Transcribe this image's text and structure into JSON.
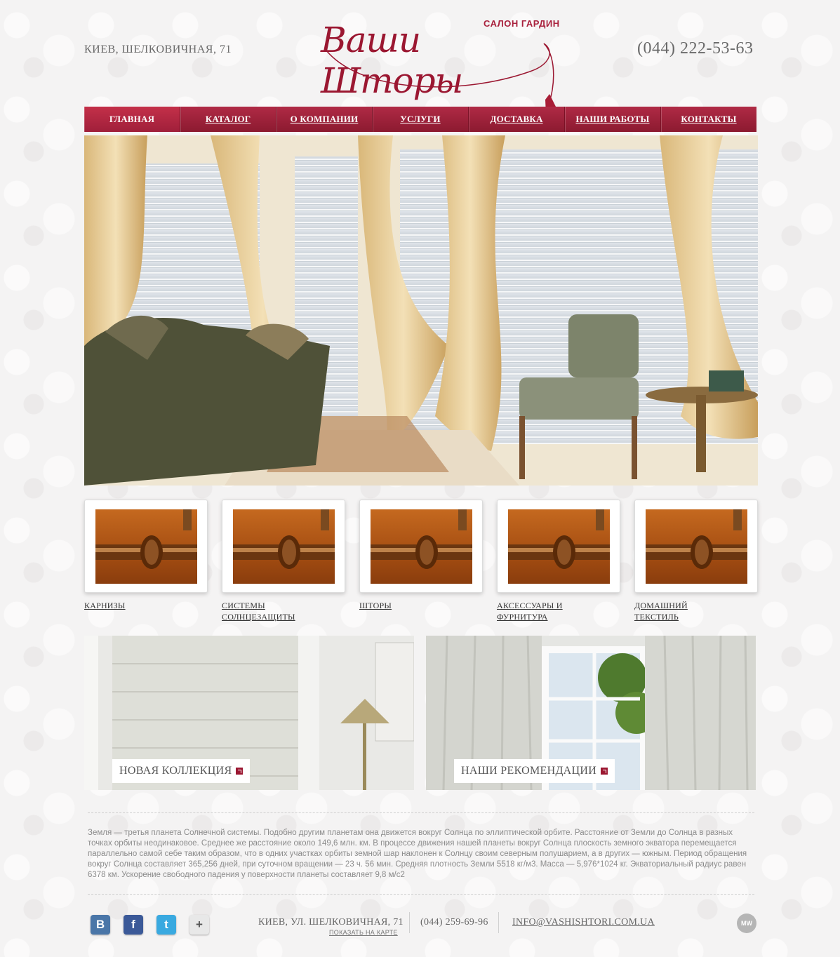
{
  "header": {
    "address": "КИЕВ, ШЕЛКОВИЧНАЯ, 71",
    "phone": "(044) 222-53-63",
    "logo_subtitle": "САЛОН ГАРДИН",
    "logo_title": "Ваши Шторы"
  },
  "nav": {
    "items": [
      {
        "label": "ГЛАВНАЯ",
        "active": true
      },
      {
        "label": "КАТАЛОГ"
      },
      {
        "label": "О КОМПАНИИ"
      },
      {
        "label": "УСЛУГИ"
      },
      {
        "label": "ДОСТАВКА"
      },
      {
        "label": "НАШИ РАБОТЫ"
      },
      {
        "label": "КОНТАКТЫ"
      }
    ]
  },
  "categories": [
    {
      "line1": "КАРНИЗЫ",
      "line2": ""
    },
    {
      "line1": "СИСТЕМЫ",
      "line2": "СОЛНЦЕЗАЩИТЫ"
    },
    {
      "line1": "ШТОРЫ",
      "line2": ""
    },
    {
      "line1": "АКСЕССУАРЫ И",
      "line2": "ФУРНИТУРА"
    },
    {
      "line1": "ДОМАШНИЙ",
      "line2": "ТЕКСТИЛЬ"
    }
  ],
  "promos": {
    "new_collection": "НОВАЯ КОЛЛЕКЦИЯ",
    "recommendations": "НАШИ РЕКОМЕНДАЦИИ"
  },
  "about_text": "Земля — третья планета Солнечной системы. Подобно другим планетам она движется вокруг Солнца по эллиптической орбите. Расстояние от Земли до Солнца в разных точках орбиты неодинаковое. Среднее же расстояние около 149,6 млн. км. В процессе движения нашей планеты вокруг Солнца плоскость земного экватора перемещается параллельно самой себе таким образом, что в одних участках орбиты земной шар наклонен к Солнцу своим северным полушарием, а в других — южным. Период обращения вокруг Солнца составляет 365,256 дней, при суточном вращении — 23 ч. 56 мин. Средняя плотность Земли 5518 кг/м3. Масса — 5,976*1024 кг. Экваториальный радиус равен 6378 км. Ускорение свободного падения у поверхности планеты составляет 9,8 м/с2",
  "footer": {
    "social": [
      {
        "icon": "vkontakte-icon",
        "glyph": "B",
        "color": "#4a76a8"
      },
      {
        "icon": "facebook-icon",
        "glyph": "f",
        "color": "#3b5998"
      },
      {
        "icon": "twitter-icon",
        "glyph": "t",
        "color": "#39a9e0"
      },
      {
        "icon": "google-plus-icon",
        "glyph": "+",
        "color": "#e8e8e8"
      }
    ],
    "address": "КИЕВ, УЛ. ШЕЛКОВИЧНАЯ, 71",
    "map_link": "ПОКАЗАТЬ НА КАРТЕ",
    "phone": "(044) 259-69-96",
    "email": "INFO@VASHISHTORI.COM.UA",
    "badge": "MW"
  }
}
